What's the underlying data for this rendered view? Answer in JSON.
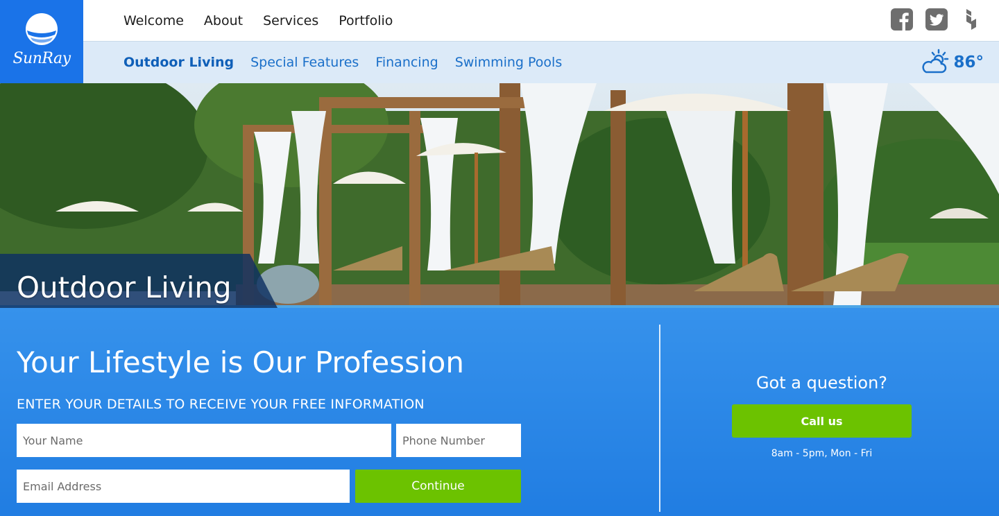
{
  "brand": {
    "logo_text": "SunRay",
    "color": "#1a73e8"
  },
  "top_nav": [
    {
      "label": "Welcome"
    },
    {
      "label": "About"
    },
    {
      "label": "Services"
    },
    {
      "label": "Portfolio"
    }
  ],
  "social": [
    "facebook-icon",
    "twitter-icon",
    "houzz-icon"
  ],
  "sub_nav": [
    {
      "label": "Outdoor Living",
      "active": true
    },
    {
      "label": "Special Features",
      "active": false
    },
    {
      "label": "Financing",
      "active": false
    },
    {
      "label": "Swimming Pools",
      "active": false
    }
  ],
  "weather": {
    "icon": "partly-sunny-icon",
    "temp": "86°"
  },
  "hero": {
    "page_title": "Outdoor Living",
    "headline": "Your Lifestyle is Our Profession",
    "subheadline": "ENTER YOUR DETAILS TO RECEIVE YOUR FREE INFORMATION"
  },
  "form": {
    "name_placeholder": "Your Name",
    "phone_placeholder": "Phone Number",
    "email_placeholder": "Email Address",
    "continue_label": "Continue"
  },
  "contact": {
    "question": "Got a question?",
    "call_label": "Call us",
    "hours": "8am - 5pm, Mon - Fri"
  },
  "colors": {
    "accent_green": "#6cc200",
    "link_blue": "#1a6fc9",
    "subnav_bg": "#dceaf8"
  }
}
